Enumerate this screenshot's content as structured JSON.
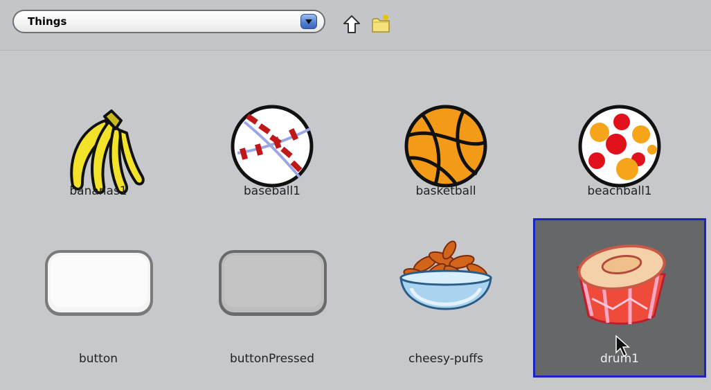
{
  "toolbar": {
    "folder_label": "Things",
    "up_icon": "up-arrow-icon",
    "new_folder_icon": "new-folder-icon"
  },
  "items": [
    {
      "label": "bananas1",
      "icon": "bananas-icon"
    },
    {
      "label": "baseball1",
      "icon": "baseball-icon"
    },
    {
      "label": "basketball",
      "icon": "basketball-icon"
    },
    {
      "label": "beachball1",
      "icon": "beachball-icon"
    },
    {
      "label": "button",
      "icon": "button-icon"
    },
    {
      "label": "buttonPressed",
      "icon": "button-pressed-icon"
    },
    {
      "label": "cheesy-puffs",
      "icon": "cheesy-puffs-icon"
    },
    {
      "label": "drum1",
      "icon": "drum-icon",
      "selected": true
    }
  ],
  "colors": {
    "background": "#c6c8cb",
    "selection_fill": "#666768",
    "selection_border": "#1a22c8"
  }
}
